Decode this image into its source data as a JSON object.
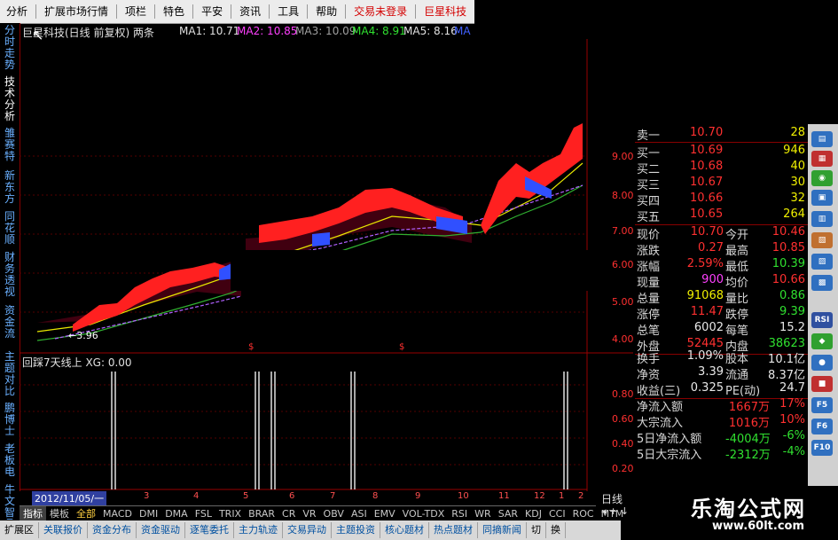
{
  "menu": {
    "items": [
      {
        "label": "分析",
        "red": false
      },
      {
        "label": "扩展市场行情",
        "red": false
      },
      {
        "label": "资讯",
        "red": false,
        "key": "x"
      },
      {
        "label": "特色",
        "red": false
      },
      {
        "label": "平安",
        "red": false
      },
      {
        "label": "资讯",
        "red": false
      },
      {
        "label": "工具",
        "red": false
      },
      {
        "label": "帮助",
        "red": false
      },
      {
        "label": "交易未登录",
        "red": true
      },
      {
        "label": "巨星科技",
        "red": true
      }
    ],
    "item0": "分析",
    "item1": "扩展市场行情",
    "item2": "项栏",
    "item3": "特色",
    "item4": "平安",
    "item5": "资讯",
    "item6": "工具",
    "item7": "帮助",
    "item8": "交易未登录",
    "item9": "巨星科技"
  },
  "left_tabs": [
    "分时走势",
    "技术分析",
    "雏赛特",
    "新东方",
    "同花顺",
    "财务透视",
    "资金流",
    "主题对比",
    "鹏博士",
    "老板电",
    "牛文智品"
  ],
  "main_header": {
    "title": "巨星科技(日线 前复权) 两条",
    "ma1": "MA1: 10.71",
    "ma2": "MA2: 10.85",
    "ma3": "MA3: 10.09",
    "ma4": "MA4: 8.91",
    "ma5": "MA5: 8.16",
    "ma6": "MA"
  },
  "price_axis": [
    "9.00",
    "8.00",
    "7.00",
    "6.00",
    "5.00",
    "4.00"
  ],
  "low_marker": "←3.96",
  "indicator_header": "回踩7天线上  XG: 0.00",
  "ind_axis": [
    "0.80",
    "0.60",
    "0.40",
    "0.20"
  ],
  "date_label": "2012/11/05/一",
  "month_labels": [
    "2",
    "3",
    "4",
    "5",
    "6",
    "7",
    "8",
    "9",
    "10",
    "11",
    "12",
    "1",
    "2"
  ],
  "period_label": "日线",
  "quote": {
    "book": [
      {
        "label": "卖一",
        "price": "10.70",
        "vol": "28"
      },
      {
        "label": "买一",
        "price": "10.69",
        "vol": "946"
      },
      {
        "label": "买二",
        "price": "10.68",
        "vol": "40"
      },
      {
        "label": "买三",
        "price": "10.67",
        "vol": "30"
      },
      {
        "label": "买四",
        "price": "10.66",
        "vol": "32"
      },
      {
        "label": "买五",
        "price": "10.65",
        "vol": "264"
      }
    ],
    "stats": [
      {
        "l1": "现价",
        "v1": "10.70",
        "c1": "red",
        "l2": "今开",
        "v2": "10.46",
        "c2": "red"
      },
      {
        "l1": "涨跌",
        "v1": "0.27",
        "c1": "red",
        "l2": "最高",
        "v2": "10.85",
        "c2": "red"
      },
      {
        "l1": "涨幅",
        "v1": "2.59%",
        "c1": "red",
        "l2": "最低",
        "v2": "10.39",
        "c2": "grn"
      },
      {
        "l1": "现量",
        "v1": "900",
        "c1": "mag",
        "l2": "均价",
        "v2": "10.66",
        "c2": "red"
      },
      {
        "l1": "总量",
        "v1": "91068",
        "c1": "yel",
        "l2": "量比",
        "v2": "0.86",
        "c2": "grn"
      },
      {
        "l1": "涨停",
        "v1": "11.47",
        "c1": "red",
        "l2": "跌停",
        "v2": "9.39",
        "c2": "grn"
      },
      {
        "l1": "总笔",
        "v1": "6002",
        "c1": "wht",
        "l2": "每笔",
        "v2": "15.2",
        "c2": "wht"
      },
      {
        "l1": "外盘",
        "v1": "52445",
        "c1": "red",
        "l2": "内盘",
        "v2": "38623",
        "c2": "grn"
      }
    ],
    "fin": [
      {
        "l1": "换手",
        "v1": "1.09%",
        "l2": "股本",
        "v2": "10.1亿"
      },
      {
        "l1": "净资",
        "v1": "3.39",
        "l2": "流通",
        "v2": "8.37亿"
      },
      {
        "l1": "收益(三)",
        "v1": "0.325",
        "l2": "PE(动)",
        "v2": "24.7"
      }
    ],
    "flow": [
      {
        "label": "净流入额",
        "val": "1667万",
        "pct": "17%",
        "c": "red"
      },
      {
        "label": "大宗流入",
        "val": "1016万",
        "pct": "10%",
        "c": "red"
      },
      {
        "label": "5日净流入额",
        "val": "-4004万",
        "pct": "-6%",
        "c": "grn"
      },
      {
        "label": "5日大宗流入",
        "val": "-2312万",
        "pct": "-4%",
        "c": "grn"
      }
    ]
  },
  "bottom_tabs": [
    "指标",
    "模板",
    "全部",
    "MACD",
    "DMI",
    "DMA",
    "FSL",
    "TRIX",
    "BRAR",
    "CR",
    "VR",
    "OBV",
    "ASI",
    "EMV",
    "VOL-TDX",
    "RSI",
    "WR",
    "SAR",
    "KDJ",
    "CCI",
    "ROC",
    "MTM"
  ],
  "status_tabs": [
    "扩展区",
    "关联报价",
    "资金分布",
    "资金驱动",
    "逐笔委托",
    "主力轨迹",
    "交易异动",
    "主题投资",
    "核心题材",
    "热点题材",
    "同摘新闻"
  ],
  "status_right": [
    "切",
    "换"
  ],
  "icon_strip": [
    "RSI",
    "F5",
    "F6",
    "F10"
  ],
  "watermark": {
    "line1": "乐淘公式网",
    "line2": "www.60lt.com"
  },
  "colors": {
    "up": "#ff3030",
    "down": "#30e030",
    "ma_pink": "#ff40ff",
    "ma_yellow": "#e8e800"
  }
}
